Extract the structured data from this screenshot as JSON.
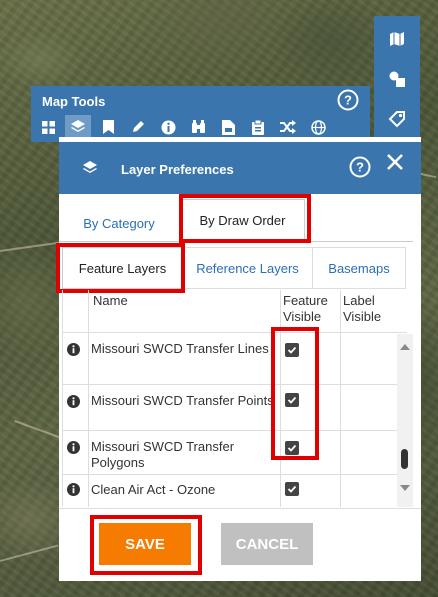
{
  "map_tools": {
    "title": "Map Tools",
    "tools": [
      {
        "icon": "grid-icon"
      },
      {
        "icon": "layers-icon",
        "active": true
      },
      {
        "icon": "bookmark-icon"
      },
      {
        "icon": "pencil-icon"
      },
      {
        "icon": "info-icon"
      },
      {
        "icon": "binoculars-icon"
      },
      {
        "icon": "print-icon"
      },
      {
        "icon": "clipboard-icon"
      },
      {
        "icon": "shuffle-icon"
      },
      {
        "icon": "globe-icon"
      }
    ]
  },
  "right_toolbar": {
    "buttons": [
      {
        "icon": "map-icon"
      },
      {
        "icon": "shapes-icon"
      },
      {
        "icon": "tag-icon"
      }
    ]
  },
  "layer_prefs": {
    "title": "Layer Preferences",
    "tabs_top": [
      {
        "label": "By Category",
        "active": false
      },
      {
        "label": "By Draw Order",
        "active": true
      }
    ],
    "tabs_sub": [
      {
        "label": "Feature Layers",
        "active": true
      },
      {
        "label": "Reference Layers",
        "active": false
      },
      {
        "label": "Basemaps",
        "active": false
      }
    ],
    "columns": {
      "name": "Name",
      "feature_visible": "Feature Visible",
      "label_visible": "Label Visible"
    },
    "rows": [
      {
        "name": "Missouri SWCD Transfer Lines",
        "feature_visible": true,
        "label_visible": false
      },
      {
        "name": "Missouri SWCD Transfer Points",
        "feature_visible": true,
        "label_visible": false
      },
      {
        "name": "Missouri SWCD Transfer Polygons",
        "feature_visible": true,
        "label_visible": false
      },
      {
        "name": "Clean Air Act - Ozone",
        "feature_visible": true,
        "label_visible": false
      }
    ],
    "save_label": "SAVE",
    "cancel_label": "CANCEL"
  },
  "colors": {
    "panel_blue": "#3a76ad",
    "save_orange": "#f57c00",
    "cancel_gray": "#c0c0c0",
    "highlight_red": "#e00000"
  }
}
